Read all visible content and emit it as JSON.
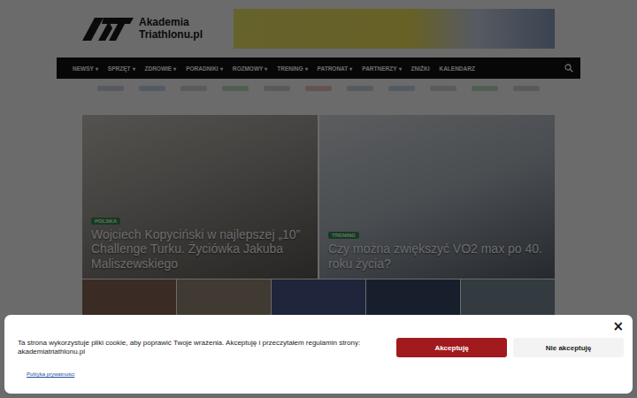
{
  "logo": {
    "line1": "Akademia",
    "line2": "Triathlonu.pl"
  },
  "nav": {
    "items": [
      {
        "label": "NEWSY",
        "dropdown": true
      },
      {
        "label": "SPRZĘT",
        "dropdown": true
      },
      {
        "label": "ZDROWIE",
        "dropdown": true
      },
      {
        "label": "PORADNIKI",
        "dropdown": true
      },
      {
        "label": "ROZMOWY",
        "dropdown": true
      },
      {
        "label": "TRENING",
        "dropdown": true
      },
      {
        "label": "PATRONAT",
        "dropdown": true
      },
      {
        "label": "PARTNERZY",
        "dropdown": true
      },
      {
        "label": "ZNIŻKI",
        "dropdown": false
      },
      {
        "label": "KALENDARZ",
        "dropdown": false
      }
    ],
    "dropdown_mark": "▾"
  },
  "hero": [
    {
      "tag": "POLSKA",
      "title": "Wojciech Kopyciński w najlepszej „10” Challenge Turku. Życiówka Jakuba Maliszewskiego"
    },
    {
      "tag": "TRENING",
      "title": "Czy można zwiększyć VO2 max po 40. roku życia?"
    }
  ],
  "cookie": {
    "message": "Ta strona wykorzystuje pliki cookie, aby poprawić Twoje wrażenia. Akceptuję i przeczytałem regulamin strony: akademiatriathlonu.pl",
    "accept": "Akceptuję",
    "decline": "Nie akceptuję",
    "close": "×",
    "policy_link": "Polityka prywatności"
  }
}
